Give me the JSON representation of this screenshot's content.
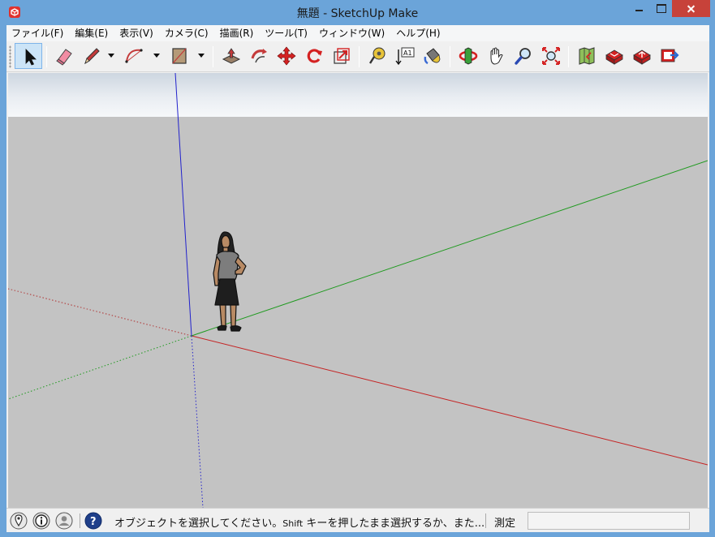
{
  "window": {
    "title": "無題 - SketchUp Make",
    "app_icon": "sketchup-logo-icon",
    "controls": [
      "minimize-icon",
      "maximize-icon",
      "close-icon"
    ],
    "accent_color": "#6ba4d9",
    "close_color": "#c7423a"
  },
  "menu": [
    {
      "label": "ファイル(F)"
    },
    {
      "label": "編集(E)"
    },
    {
      "label": "表示(V)"
    },
    {
      "label": "カメラ(C)"
    },
    {
      "label": "描画(R)"
    },
    {
      "label": "ツール(T)"
    },
    {
      "label": "ウィンドウ(W)"
    },
    {
      "label": "ヘルプ(H)"
    }
  ],
  "toolbar": {
    "tools": [
      {
        "name": "select-tool",
        "icon": "arrow-cursor-icon",
        "active": true
      },
      {
        "name": "eraser-tool",
        "icon": "eraser-icon"
      },
      {
        "name": "line-tool",
        "icon": "pencil-icon",
        "has_dropdown": true
      },
      {
        "name": "arc-tool",
        "icon": "arc-icon",
        "has_dropdown": true
      },
      {
        "name": "rectangle-tool",
        "icon": "rectangle-icon",
        "has_dropdown": true
      },
      {
        "name": "push-pull-tool",
        "icon": "push-pull-icon"
      },
      {
        "name": "offset-tool",
        "icon": "offset-icon"
      },
      {
        "name": "move-tool",
        "icon": "move-arrows-icon"
      },
      {
        "name": "rotate-tool",
        "icon": "rotate-icon"
      },
      {
        "name": "scale-tool",
        "icon": "scale-icon"
      },
      {
        "name": "tape-measure-tool",
        "icon": "tape-measure-icon"
      },
      {
        "name": "text-tool",
        "icon": "text-label-icon",
        "glyph": "A1"
      },
      {
        "name": "paint-bucket-tool",
        "icon": "paint-bucket-icon"
      },
      {
        "name": "orbit-tool",
        "icon": "orbit-icon"
      },
      {
        "name": "pan-tool",
        "icon": "hand-icon"
      },
      {
        "name": "zoom-tool",
        "icon": "magnifier-icon"
      },
      {
        "name": "zoom-extents-tool",
        "icon": "zoom-extents-icon"
      },
      {
        "name": "add-location-tool",
        "icon": "map-location-icon"
      },
      {
        "name": "3d-warehouse-tool",
        "icon": "warehouse-icon"
      },
      {
        "name": "share-model-tool",
        "icon": "share-model-icon"
      },
      {
        "name": "extension-warehouse-tool",
        "icon": "extension-warehouse-icon"
      }
    ]
  },
  "viewport": {
    "background_color": "#c3c3c3",
    "sky_color": "#dde4ec",
    "axes": {
      "red": "#cc2222",
      "green": "#22aa22",
      "blue": "#2222cc"
    },
    "figure": "person-figure"
  },
  "status": {
    "icons": [
      "geo-location-icon",
      "info-icon",
      "user-icon",
      "help-icon"
    ],
    "message_before": "オブジェクトを選択してください。",
    "message_key": "Shift",
    "message_after": " キーを押したまま選択するか、また...",
    "measure_label": "測定",
    "measure_value": ""
  }
}
